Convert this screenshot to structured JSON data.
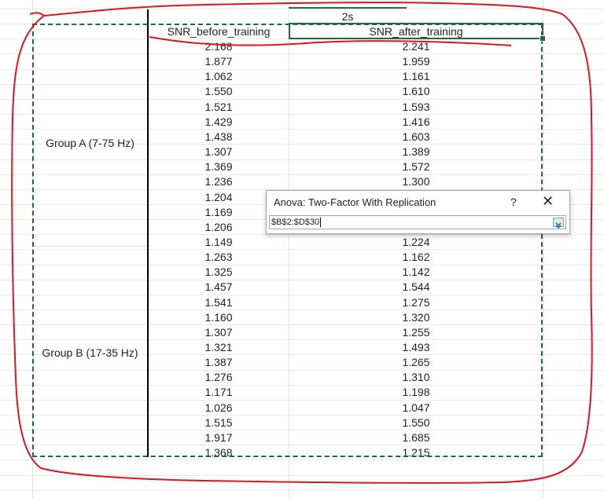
{
  "header": {
    "top_label": "2s",
    "col_before": "SNR_before_training",
    "col_after": "SNR_after_training"
  },
  "groups": [
    {
      "label": "Group A (7-75 Hz)"
    },
    {
      "label": "Group B (17-35 Hz)"
    }
  ],
  "rows": [
    {
      "before": "2.168",
      "after": "2.241"
    },
    {
      "before": "1.877",
      "after": "1.959"
    },
    {
      "before": "1.062",
      "after": "1.161"
    },
    {
      "before": "1.550",
      "after": "1.610"
    },
    {
      "before": "1.521",
      "after": "1.593"
    },
    {
      "before": "1.429",
      "after": "1.416"
    },
    {
      "before": "1.438",
      "after": "1.603"
    },
    {
      "before": "1.307",
      "after": "1.389"
    },
    {
      "before": "1.369",
      "after": "1.572"
    },
    {
      "before": "1.236",
      "after": "1.300"
    },
    {
      "before": "1.204",
      "after": ""
    },
    {
      "before": "1.169",
      "after": ""
    },
    {
      "before": "1.206",
      "after": ""
    },
    {
      "before": "1.149",
      "after": "1.224"
    },
    {
      "before": "1.263",
      "after": "1.162"
    },
    {
      "before": "1.325",
      "after": "1.142"
    },
    {
      "before": "1.457",
      "after": "1.544"
    },
    {
      "before": "1.541",
      "after": "1.275"
    },
    {
      "before": "1.160",
      "after": "1.320"
    },
    {
      "before": "1.307",
      "after": "1.255"
    },
    {
      "before": "1.321",
      "after": "1.493"
    },
    {
      "before": "1.387",
      "after": "1.265"
    },
    {
      "before": "1.276",
      "after": "1.310"
    },
    {
      "before": "1.171",
      "after": "1.198"
    },
    {
      "before": "1.026",
      "after": "1.047"
    },
    {
      "before": "1.515",
      "after": "1.550"
    },
    {
      "before": "1.917",
      "after": "1.685"
    },
    {
      "before": "1.368",
      "after": "1.215"
    }
  ],
  "dialog": {
    "title": "Anova: Two-Factor With Replication",
    "help": "?",
    "close": "✕",
    "range_value": "$B$2:$D$30"
  },
  "colors": {
    "selection": "#1d6b3a",
    "annotation": "#e0141e"
  },
  "icons": {
    "collapse": "collapse-dialog-icon",
    "close": "close-icon",
    "help": "help-icon"
  }
}
